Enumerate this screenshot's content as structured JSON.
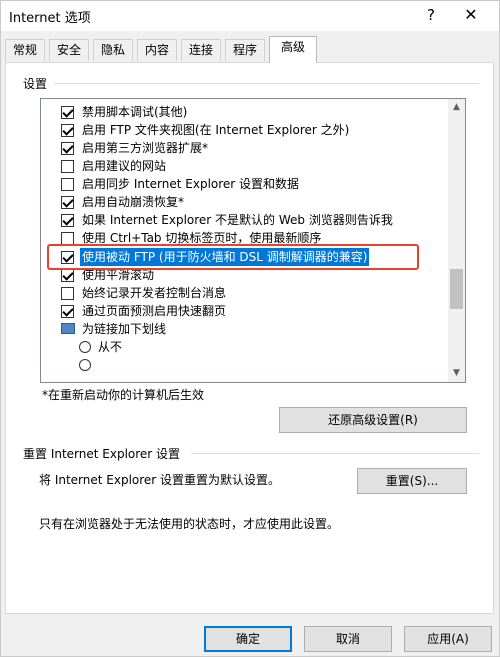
{
  "window": {
    "title": "Internet 选项",
    "help": "?",
    "close": "✕"
  },
  "tabs": [
    {
      "label": "常规"
    },
    {
      "label": "安全"
    },
    {
      "label": "隐私"
    },
    {
      "label": "内容"
    },
    {
      "label": "连接"
    },
    {
      "label": "程序"
    },
    {
      "label": "高级",
      "active": true
    }
  ],
  "settings": {
    "section_label": "设置",
    "items": [
      {
        "label": "禁用脚本调试(其他)",
        "checked": true
      },
      {
        "label": "启用 FTP 文件夹视图(在 Internet Explorer 之外)",
        "checked": true
      },
      {
        "label": "启用第三方浏览器扩展*",
        "checked": true
      },
      {
        "label": "启用建议的网站",
        "checked": false
      },
      {
        "label": "启用同步 Internet Explorer 设置和数据",
        "checked": false
      },
      {
        "label": "启用自动崩溃恢复*",
        "checked": true
      },
      {
        "label": "如果 Internet Explorer 不是默认的 Web 浏览器则告诉我",
        "checked": true
      },
      {
        "label": "使用 Ctrl+Tab 切换标签页时，使用最新顺序",
        "checked": false
      },
      {
        "label": "使用被动 FTP (用于防火墙和 DSL 调制解调器的兼容)",
        "checked": true,
        "selected": true
      },
      {
        "label": "使用平滑滚动",
        "checked": true
      },
      {
        "label": "始终记录开发者控制台消息",
        "checked": false
      },
      {
        "label": "通过页面预测启用快速翻页",
        "checked": true
      }
    ],
    "group_label": "为链接加下划线",
    "radio_label": "从不",
    "scroll_up": "▲",
    "scroll_down": "▼"
  },
  "restart_note": "*在重新启动你的计算机后生效",
  "restore_button": "还原高级设置(R)",
  "reset": {
    "section_label": "重置 Internet Explorer 设置",
    "description": "将 Internet Explorer 设置重置为默认设置。",
    "button": "重置(S)...",
    "note": "只有在浏览器处于无法使用的状态时，才应使用此设置。"
  },
  "footer": {
    "ok": "确定",
    "cancel": "取消",
    "apply": "应用(A)"
  },
  "colors": {
    "selection": "#0078d7",
    "highlight_border": "#e8412c"
  }
}
